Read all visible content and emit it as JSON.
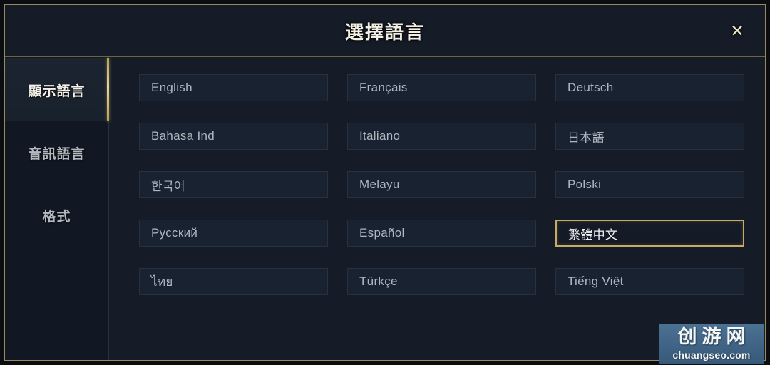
{
  "dialog": {
    "title": "選擇語言",
    "close_label": "✕",
    "close_icon": "close-icon",
    "accent_color": "#c8ab62",
    "border_color": "#9a8a5c",
    "background_color": "#151c27"
  },
  "sidebar": {
    "items": [
      {
        "label": "顯示語言",
        "active": true
      },
      {
        "label": "音訊語言",
        "active": false
      },
      {
        "label": "格式",
        "active": false
      }
    ]
  },
  "languages": [
    {
      "label": "English",
      "selected": false
    },
    {
      "label": "Français",
      "selected": false
    },
    {
      "label": "Deutsch",
      "selected": false
    },
    {
      "label": "Bahasa Ind",
      "selected": false
    },
    {
      "label": "Italiano",
      "selected": false
    },
    {
      "label": "日本語",
      "selected": false
    },
    {
      "label": "한국어",
      "selected": false
    },
    {
      "label": "Melayu",
      "selected": false
    },
    {
      "label": "Polski",
      "selected": false
    },
    {
      "label": "Русский",
      "selected": false
    },
    {
      "label": "Español",
      "selected": false
    },
    {
      "label": "繁體中文",
      "selected": true
    },
    {
      "label": "ไทย",
      "selected": false
    },
    {
      "label": "Türkçe",
      "selected": false
    },
    {
      "label": "Tiếng Việt",
      "selected": false
    }
  ],
  "watermark": {
    "brand": "创游网",
    "url": "chuangseo.com"
  }
}
